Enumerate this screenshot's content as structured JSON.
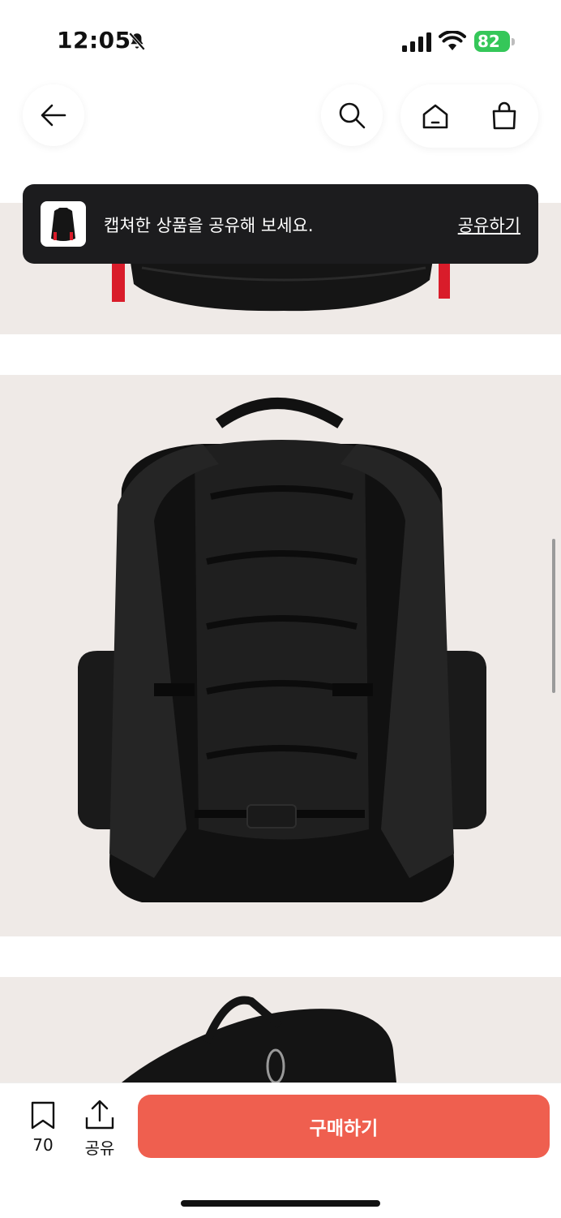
{
  "status_bar": {
    "time": "12:05",
    "battery": "82"
  },
  "icons": {
    "back": "arrow-left-icon",
    "search": "search-icon",
    "home": "home-icon",
    "cart": "shopping-bag-icon",
    "bookmark": "bookmark-icon",
    "share": "share-icon"
  },
  "toast": {
    "message": "캡쳐한 상품을 공유해 보세요.",
    "action": "공유하기"
  },
  "bottom_bar": {
    "bookmark_count": "70",
    "share_label": "공유",
    "buy_label": "구매하기"
  },
  "colors": {
    "accent": "#ef5f4f",
    "image_bg": "#efeae7",
    "toast_bg": "#1c1c1e",
    "battery": "#35c759"
  }
}
